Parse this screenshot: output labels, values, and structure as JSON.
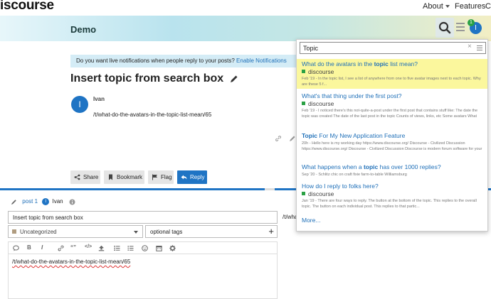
{
  "site": {
    "logo": "iscourse",
    "nav": [
      "About",
      "Features",
      "Co"
    ]
  },
  "header": {
    "title": "Demo",
    "notification_count": "1",
    "user_initial": "I"
  },
  "banner": {
    "text": "Do you want live notifications when people reply to your posts?",
    "link": "Enable Notifications"
  },
  "topic": {
    "title": "Insert topic from search box",
    "post": {
      "initial": "I",
      "username": "Ivan",
      "body": "/t/what-do-the-avatars-in-the-topic-list-mean/65"
    },
    "actions": [
      "Share",
      "Bookmark",
      "Flag",
      "Reply"
    ]
  },
  "composer": {
    "post_ref": "post 1",
    "user_initial": "I",
    "username": "Ivan",
    "title_value": "Insert topic from search box",
    "preview_text": "/t/wha",
    "category": "Uncategorized",
    "tags_placeholder": "optional tags",
    "toolbar": [
      "B",
      "I",
      "“”",
      "</>"
    ],
    "body": "/t/what-do-the-avatars-in-the-topic-list-mean/65"
  },
  "search": {
    "query": "Topic",
    "clear_label": "×",
    "results": [
      {
        "title_before": "What do the avatars in the ",
        "title_hit": "topic",
        "title_after": " list mean?",
        "category": "discourse",
        "blurb": "Feb '19 - In the topic list, I see a list of anywhere from one to five avatar images next to each topic. Why are these 5 f..."
      },
      {
        "title_before": "What's that thing under the first post?",
        "title_hit": "",
        "title_after": "",
        "category": "discourse",
        "blurb": "Feb '19 - I noticed there's this not-quite-a-post under the first post that contains stuff like: The date the topic was created The date of the last post in the topic Counts of views, links, etc Some avatars What pu..."
      },
      {
        "title_before": "",
        "title_hit": "Topic",
        "title_after": " For My New Application Feature",
        "category": "",
        "blurb": "20h - Hello here is my working day https://www.discourse.org/ Discourse - Civilized Discussion https://www.discourse.org/ Discourse - Civilized Discussion Discourse is modern forum software for your comm..."
      },
      {
        "title_before": "What happens when a ",
        "title_hit": "topic",
        "title_after": " has over 1000 replies?",
        "category": "",
        "blurb": "Sep '20 - Schlitz chic on craft fixie farm-to-table Williamsburg"
      },
      {
        "title_before": "How do I reply to folks here?",
        "title_hit": "",
        "title_after": "",
        "category": "discourse",
        "blurb": "Jan '19 - There are four ways to reply. The button at the bottom of the topic. This replies to the overall topic. The button on each individual post. This replies to that partic..."
      }
    ],
    "more_label": "More..."
  },
  "colors": {
    "accent": "#1f74c4",
    "highlight": "#fbf79d",
    "category_green": "#2aa144",
    "category_tan": "#b09c80"
  }
}
